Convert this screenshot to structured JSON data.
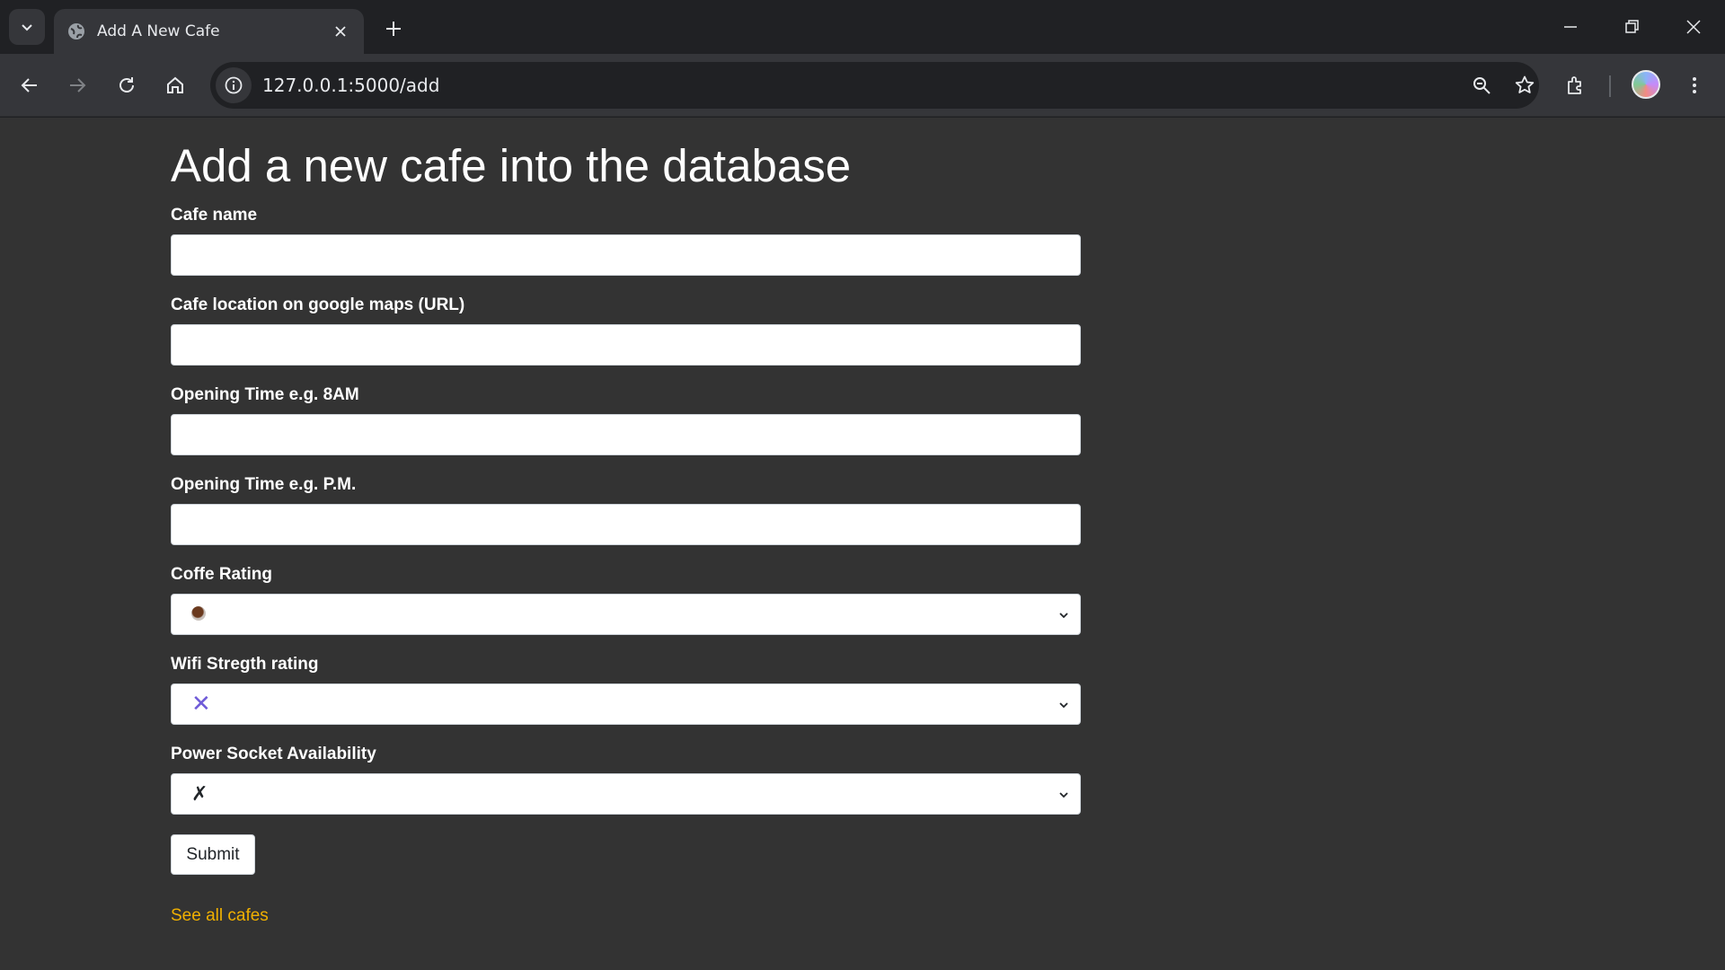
{
  "browser": {
    "tab_title": "Add A New Cafe",
    "url": "127.0.0.1:5000/add"
  },
  "page": {
    "title": "Add a new cafe into the database",
    "fields": {
      "cafe_name": {
        "label": "Cafe name",
        "value": ""
      },
      "location": {
        "label": "Cafe location on google maps (URL)",
        "value": ""
      },
      "opening_time": {
        "label": "Opening Time e.g. 8AM",
        "value": ""
      },
      "closing_time": {
        "label": "Opening Time e.g. P.M.",
        "value": ""
      },
      "coffee_rating": {
        "label": "Coffe Rating",
        "selected": "☕"
      },
      "wifi_rating": {
        "label": "Wifi Stregth rating",
        "selected": "✕"
      },
      "power_socket": {
        "label": "Power Socket Availability",
        "selected": "✗"
      }
    },
    "submit_label": "Submit",
    "see_all_link": "See all cafes"
  },
  "colors": {
    "page_bg": "#333333",
    "link": "#f0b000",
    "wifi_x": "#6f5bd8"
  }
}
